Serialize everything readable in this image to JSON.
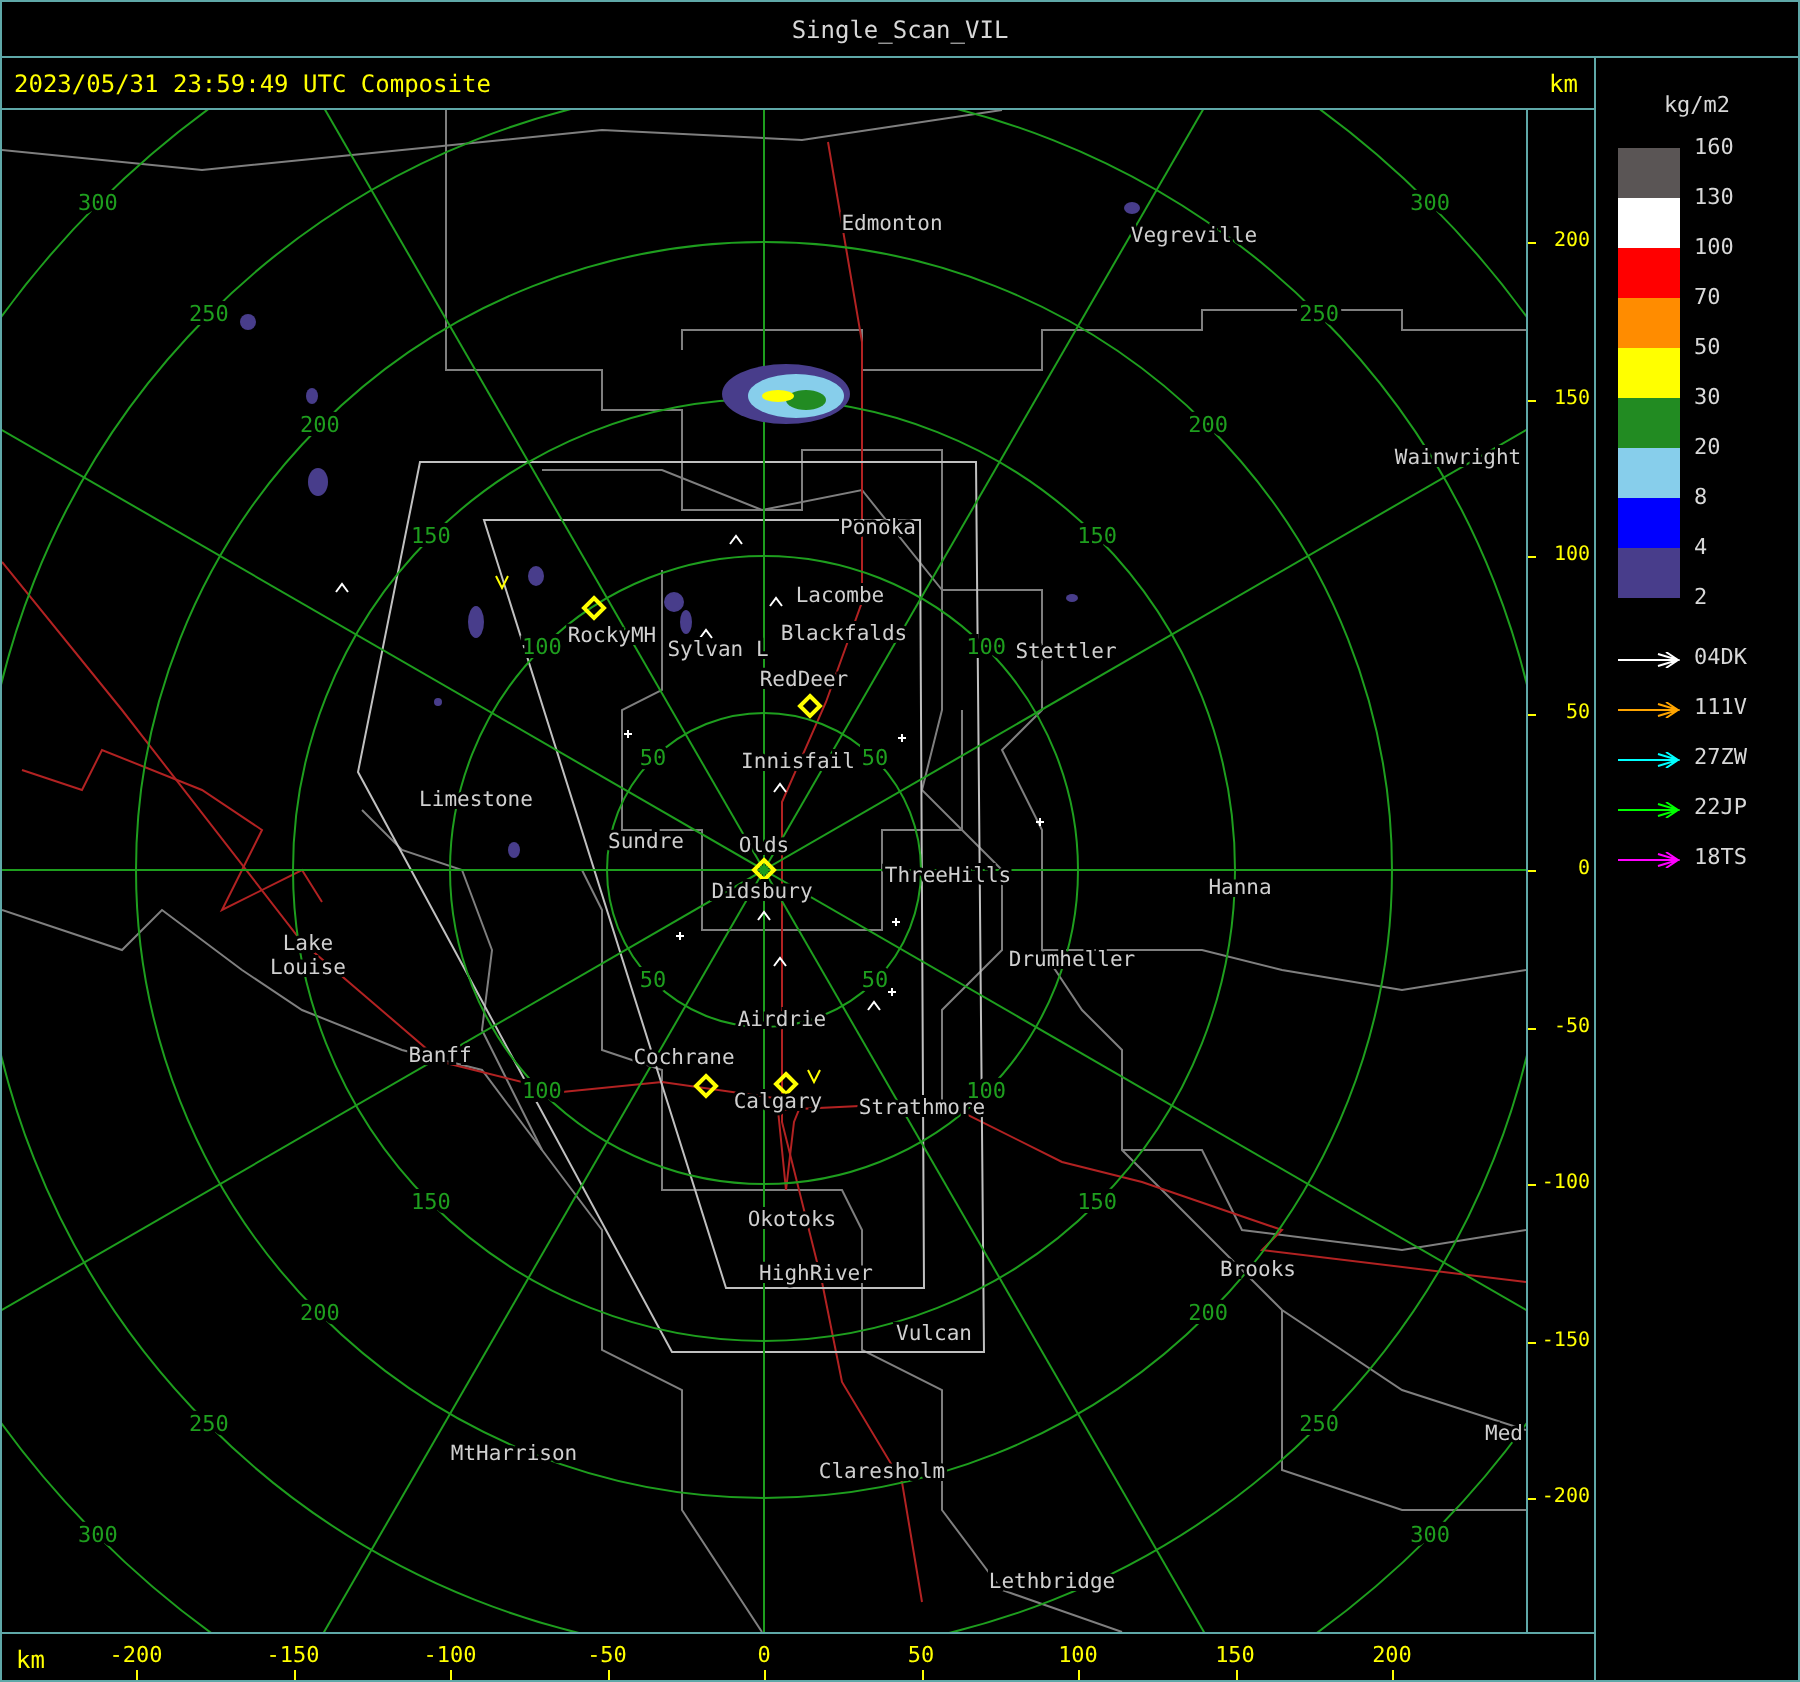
{
  "window": {
    "title": "Single_Scan_VIL"
  },
  "header": {
    "timestamp": "2023/05/31 23:59:49 UTC Composite",
    "unit": "km"
  },
  "map": {
    "places": [
      "Edmonton",
      "Vegreville",
      "Wainwright",
      "Ponoka",
      "Lacombe",
      "Blackfalds",
      "Stettler",
      "RockyMH",
      "Sylvan L",
      "RedDeer",
      "Innisfail",
      "Limestone",
      "Sundre",
      "Olds",
      "ThreeHills",
      "Didsbury",
      "Hanna",
      "Lake Louise",
      "Drumheller",
      "Airdrie",
      "Banff",
      "Cochrane",
      "Calgary",
      "Strathmore",
      "Okotoks",
      "HighRiver",
      "Brooks",
      "Vulcan",
      "MtHarrison",
      "Claresholm",
      "Lethbridge",
      "Med"
    ],
    "range_rings": [
      {
        "labels": [
          "50",
          "50",
          "50",
          "50"
        ]
      },
      {
        "labels": [
          "100",
          "100",
          "100",
          "100"
        ]
      },
      {
        "labels": [
          "150",
          "150",
          "150",
          "150"
        ]
      },
      {
        "labels": [
          "200",
          "200",
          "200",
          "200"
        ]
      },
      {
        "labels": [
          "250",
          "250",
          "250",
          "250"
        ]
      },
      {
        "labels": [
          "300",
          "300",
          "300",
          "300"
        ]
      }
    ]
  },
  "y_axis": {
    "ticks": [
      "200",
      "150",
      "100",
      "50",
      "0",
      "-50",
      "-100",
      "-150",
      "-200"
    ]
  },
  "x_axis": {
    "unit": "km",
    "ticks": [
      "-200",
      "-150",
      "-100",
      "-50",
      "0",
      "50",
      "100",
      "150",
      "200"
    ]
  },
  "legend": {
    "unit": "kg/m2",
    "band_labels": [
      "160",
      "130",
      "100",
      "70",
      "50",
      "30",
      "20",
      "8",
      "4",
      "2"
    ],
    "bands": [
      {
        "color": "#5a5555"
      },
      {
        "color": "#ffffff"
      },
      {
        "color": "#ff0000"
      },
      {
        "color": "#ff8c00"
      },
      {
        "color": "#ffff00"
      },
      {
        "color": "#228b22"
      },
      {
        "color": "#87ceeb"
      },
      {
        "color": "#0000ff"
      },
      {
        "color": "#483d8b"
      }
    ],
    "tracks": [
      {
        "label": "04DK",
        "color": "#ffffff"
      },
      {
        "label": "111V",
        "color": "#ffa500"
      },
      {
        "label": "27ZW",
        "color": "#00ffff"
      },
      {
        "label": "22JP",
        "color": "#00ff00"
      },
      {
        "label": "18TS",
        "color": "#ff00ff"
      }
    ]
  }
}
